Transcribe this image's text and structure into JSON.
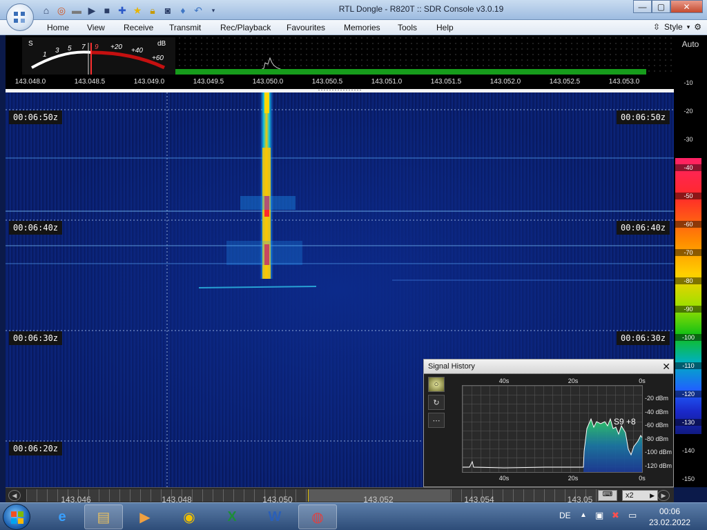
{
  "window": {
    "title": "RTL Dongle - R820T :: SDR Console v3.0.19",
    "minimize": "—",
    "maximize": "▢",
    "close": "✕"
  },
  "menu": {
    "items": [
      "Home",
      "View",
      "Receive",
      "Transmit",
      "Rec/Playback",
      "Favourites",
      "Memories",
      "Tools",
      "Help"
    ],
    "style_label": "Style"
  },
  "smeter": {
    "s_label": "S",
    "db_label": "dB",
    "scale": [
      "1",
      "3",
      "5",
      "7",
      "9",
      "+20",
      "+40",
      "+60"
    ]
  },
  "frequency_scale": [
    "143.048.0",
    "143.048.5",
    "143.049.0",
    "143.049.5",
    "143.050.0",
    "143.050.5",
    "143.051.0",
    "143.051.5",
    "143.052.0",
    "143.052.5",
    "143.053.0"
  ],
  "waterfall": {
    "timestamps": [
      "00:06:50z",
      "00:06:40z",
      "00:06:30z",
      "00:06:20z"
    ]
  },
  "palette": {
    "auto_label": "Auto",
    "db_scale": [
      "-10",
      "-20",
      "-30",
      "-40",
      "-50",
      "-60",
      "-70",
      "-80",
      "-90",
      "-100",
      "-110",
      "-120",
      "-130",
      "-140",
      "-150"
    ]
  },
  "signal_history": {
    "title": "Signal History",
    "close": "✕",
    "time_labels": [
      "40s",
      "20s",
      "0s"
    ],
    "dbm_labels": [
      "-20 dBm",
      "-40 dBm",
      "-60 dBm",
      "-80 dBm",
      "-100 dBm",
      "-120 dBm"
    ],
    "reading": "S9 +8",
    "buttons": [
      "○",
      "↻",
      "⋯"
    ]
  },
  "bottom_scroller": {
    "labels": [
      "143.046",
      "143.048",
      "143.050",
      "143.052",
      "143.054",
      "143.05"
    ],
    "zoom": "x2"
  },
  "taskbar": {
    "language": "DE",
    "time": "00:06",
    "date": "23.02.2022"
  },
  "colors": {
    "waterfall_bg": "#0a2070",
    "signal_core": "#ff2a2a",
    "spectrum_green": "#179c1c"
  }
}
